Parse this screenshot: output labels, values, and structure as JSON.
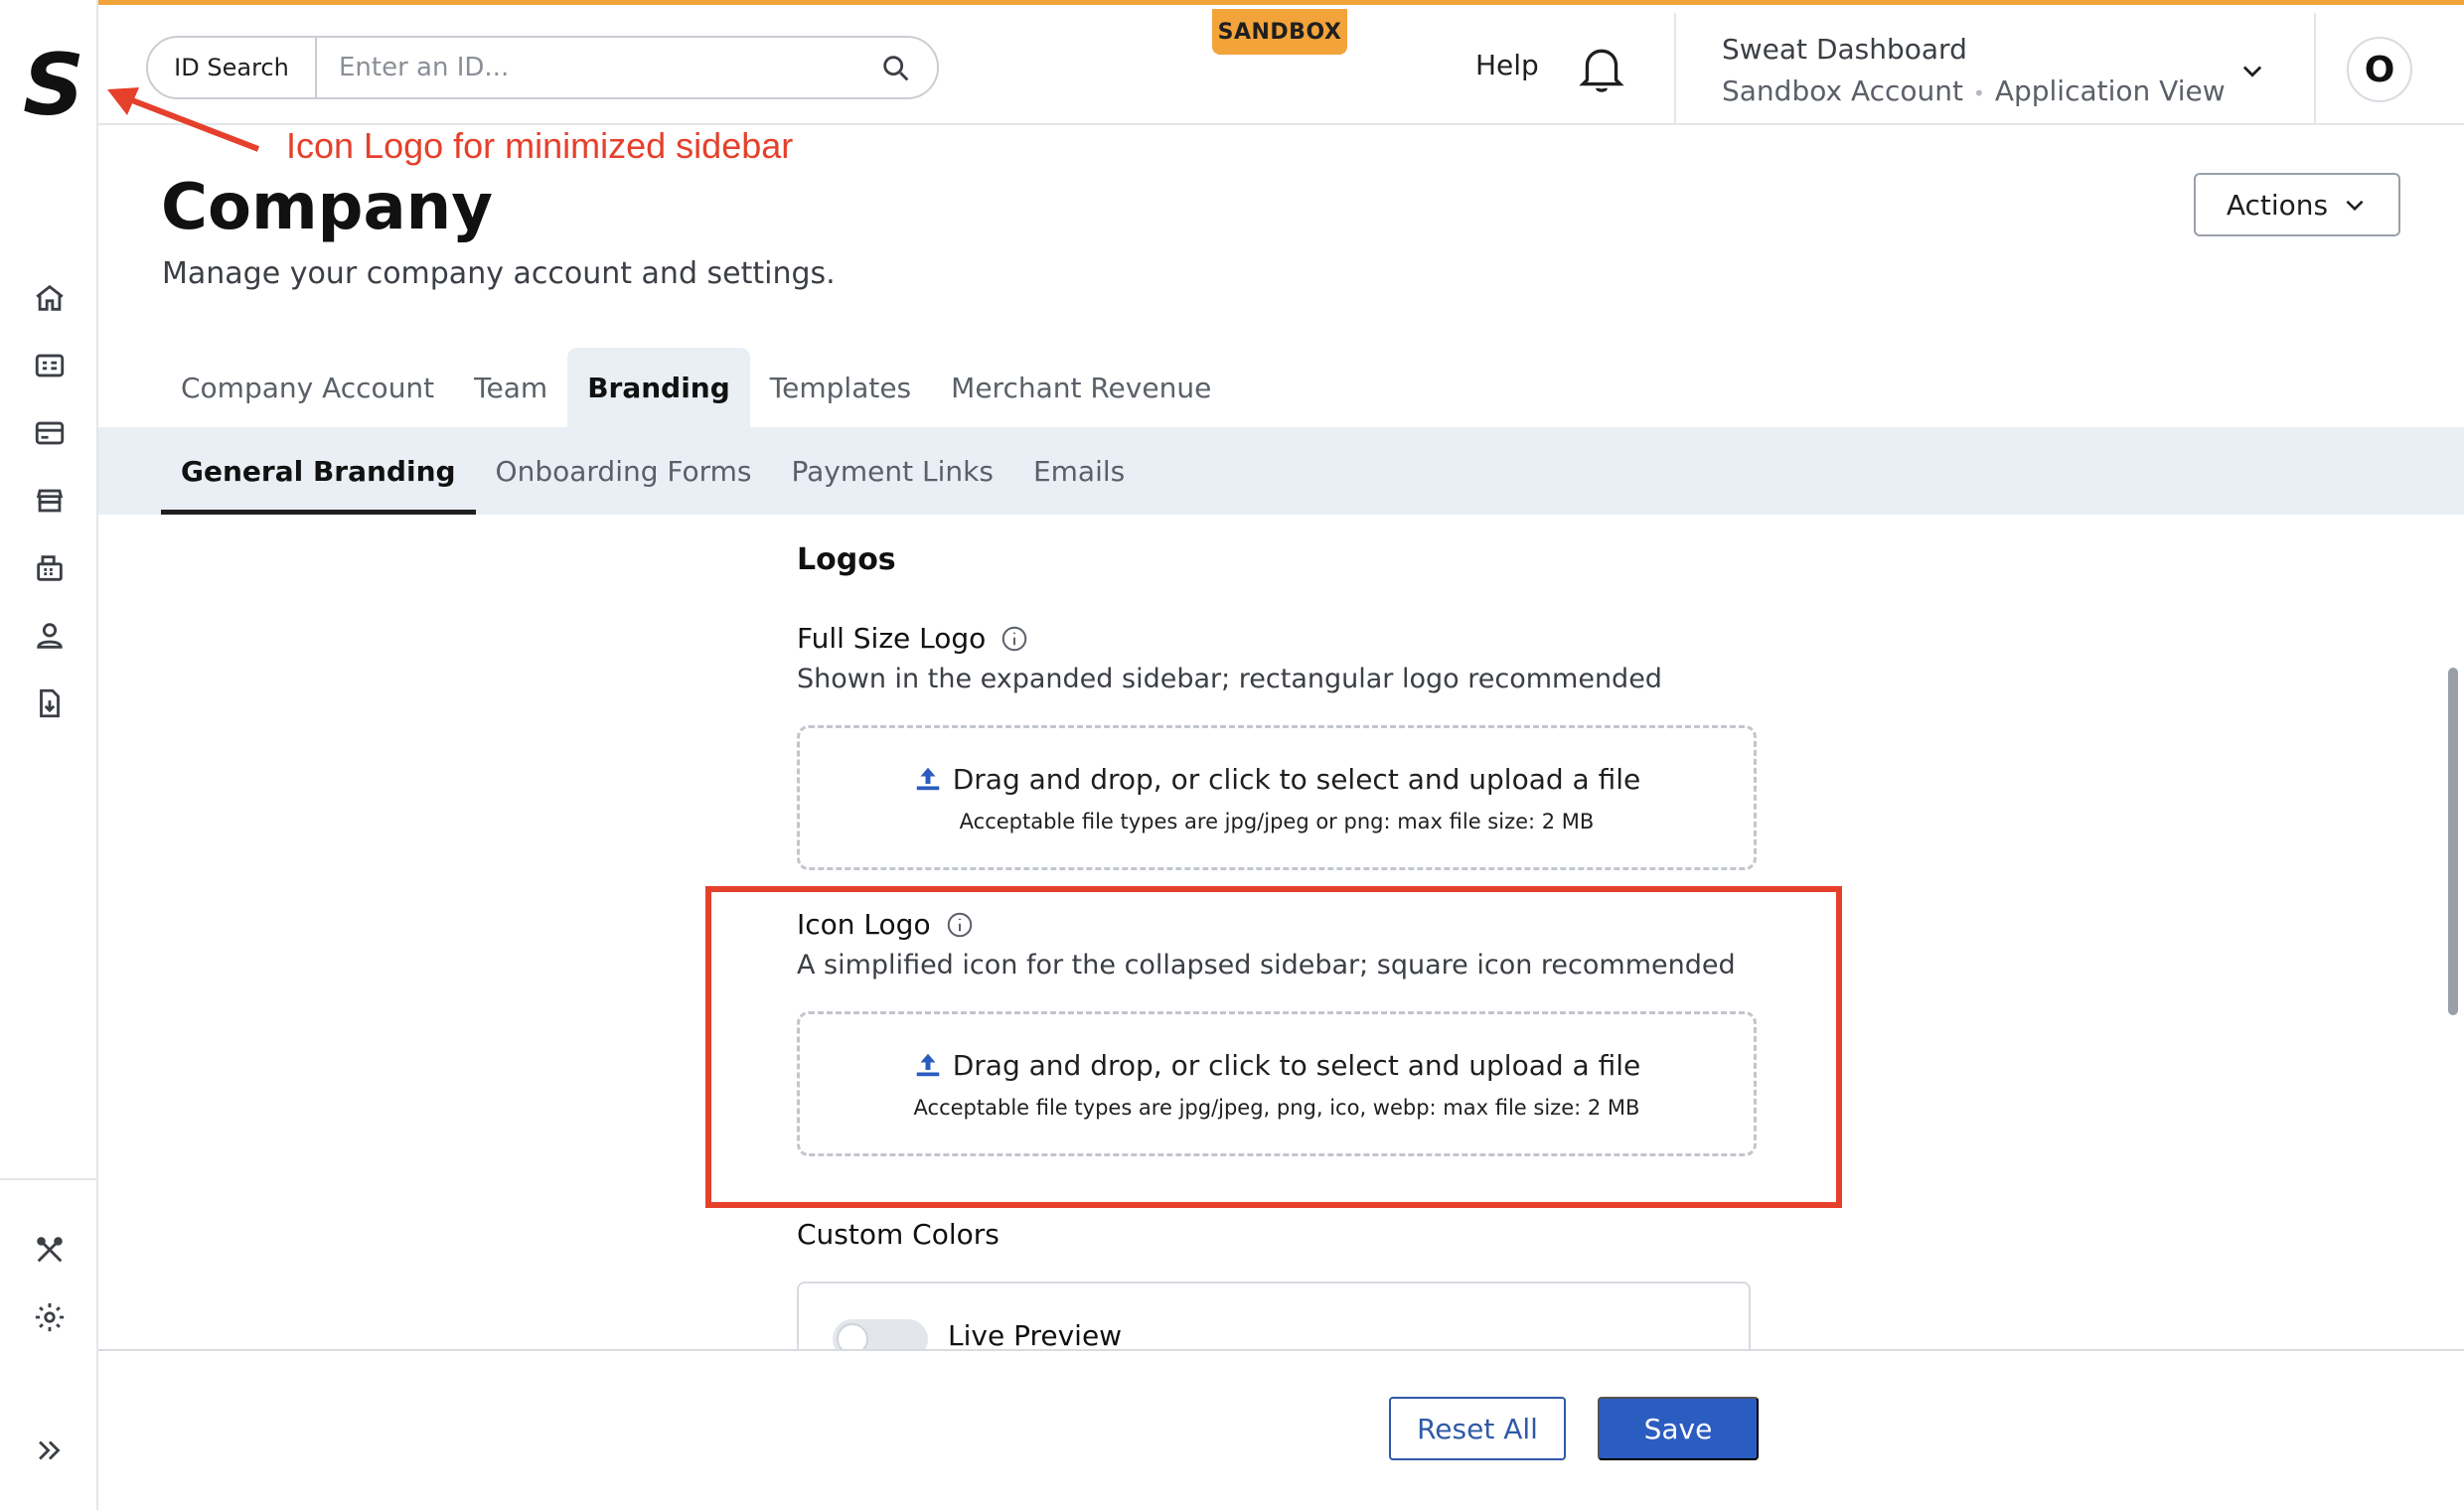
{
  "sidebar": {
    "logo": "S",
    "nav_icons": [
      "home-icon",
      "billing-icon",
      "card-icon",
      "storefront-icon",
      "register-icon",
      "user-icon",
      "document-download-icon"
    ],
    "bottom_icons": [
      "tools-icon",
      "gear-icon"
    ],
    "expand_icon": "double-chevron-right-icon"
  },
  "topbar": {
    "search_label": "ID Search",
    "search_placeholder": "Enter an ID...",
    "badge": "SANDBOX",
    "help": "Help",
    "account_name": "Sweat Dashboard",
    "account_type": "Sandbox Account",
    "account_view": "Application View",
    "avatar_initial": "O"
  },
  "annotation": {
    "text": "Icon Logo for minimized sidebar",
    "color": "#e5402b"
  },
  "header": {
    "title": "Company",
    "subtitle": "Manage your company account and settings.",
    "actions_label": "Actions"
  },
  "tabs": [
    "Company Account",
    "Team",
    "Branding",
    "Templates",
    "Merchant Revenue"
  ],
  "active_tab": "Branding",
  "subtabs": [
    "General Branding",
    "Onboarding Forms",
    "Payment Links",
    "Emails"
  ],
  "active_subtab": "General Branding",
  "logos": {
    "section_title": "Logos",
    "full_size": {
      "label": "Full Size Logo",
      "description": "Shown in the expanded sidebar; rectangular logo recommended",
      "drop_text": "Drag and drop, or click to select and upload a file",
      "file_types": "Acceptable file types are jpg/jpeg or png: max file size: 2 MB"
    },
    "icon": {
      "label": "Icon Logo",
      "description": "A simplified icon for the collapsed sidebar; square icon recommended",
      "drop_text": "Drag and drop, or click to select and upload a file",
      "file_types": "Acceptable file types are jpg/jpeg, png, ico, webp: max file size: 2 MB"
    }
  },
  "custom_colors": {
    "title": "Custom Colors",
    "live_preview_label": "Live Preview"
  },
  "footer": {
    "reset_label": "Reset All",
    "save_label": "Save"
  },
  "colors": {
    "accent": "#2b5cc0",
    "sandbox": "#f2a33a",
    "highlight": "#e5402b"
  }
}
